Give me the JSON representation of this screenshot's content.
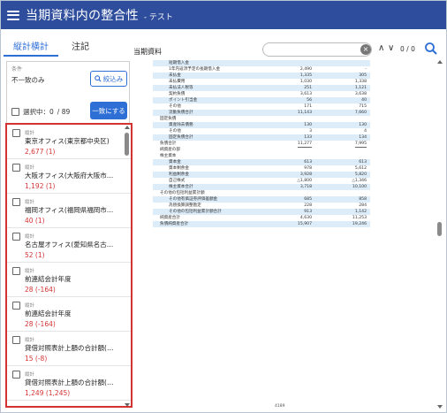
{
  "header": {
    "title": "当期資料内の整合性",
    "subtitle": "- テスト"
  },
  "tabs": [
    {
      "label": "縦計横計"
    },
    {
      "label": "注記"
    }
  ],
  "condition": {
    "label": "条件",
    "value": "不一致のみ",
    "narrow_button": "絞込み"
  },
  "selection": {
    "label": "選択中：0",
    "total": "/ 89",
    "match_button": "一致にする"
  },
  "list": [
    {
      "tag": "縦計",
      "name": "東京オフィス(東京都中央区)",
      "value": "2,677 (1)"
    },
    {
      "tag": "縦計",
      "name": "大阪オフィス(大阪府大阪市北区)",
      "value": "1,192 (1)"
    },
    {
      "tag": "縦計",
      "name": "福岡オフィス(福岡県福岡市博...",
      "value": "40 (1)"
    },
    {
      "tag": "縦計",
      "name": "名古屋オフィス(愛知県名古屋...",
      "value": "52 (1)"
    },
    {
      "tag": "縦計",
      "name": "前連結会計年度",
      "value": "28 (-164)"
    },
    {
      "tag": "縦計",
      "name": "前連結会計年度",
      "value": "28 (-164)"
    },
    {
      "tag": "縦計",
      "name": "貸借対照表計上額の合計額(百...",
      "value": "15 (-8)"
    },
    {
      "tag": "縦計",
      "name": "貸借対照表計上額の合計額(百...",
      "value": "1,249 (1,245)"
    }
  ],
  "viewer": {
    "doc_label": "当期資料",
    "search_placeholder": "",
    "match_count": "0 / 0",
    "page_footer": "4189"
  },
  "doc_rows": [
    {
      "label": "短期借入金",
      "c1": "",
      "c2": "",
      "indent": 1,
      "hl": true
    },
    {
      "label": "1年内返済予定の長期借入金",
      "c1": "2,490",
      "c2": "-",
      "indent": 1,
      "hl": false
    },
    {
      "label": "未払金",
      "c1": "1,335",
      "c2": "305",
      "indent": 1,
      "hl": true
    },
    {
      "label": "未払費用",
      "c1": "1,030",
      "c2": "1,338",
      "indent": 1,
      "hl": false
    },
    {
      "label": "未払法人税等",
      "c1": "251",
      "c2": "1,121",
      "indent": 1,
      "hl": true
    },
    {
      "label": "契約負債",
      "c1": "3,613",
      "c2": "3,638",
      "indent": 1,
      "hl": false
    },
    {
      "label": "ポイント引当金",
      "c1": "56",
      "c2": "40",
      "indent": 1,
      "hl": true
    },
    {
      "label": "その他",
      "c1": "171",
      "c2": "715",
      "indent": 1,
      "hl": false,
      "uline": true
    },
    {
      "label": "流動負債合計",
      "c1": "11,143",
      "c2": "7,660",
      "indent": 1,
      "hl": true
    },
    {
      "label": "固定負債",
      "c1": "",
      "c2": "",
      "indent": 0,
      "hl": false
    },
    {
      "label": "資産除去債務",
      "c1": "130",
      "c2": "130",
      "indent": 1,
      "hl": true
    },
    {
      "label": "その他",
      "c1": "3",
      "c2": "4",
      "indent": 1,
      "hl": false,
      "uline": true
    },
    {
      "label": "固定負債合計",
      "c1": "133",
      "c2": "134",
      "indent": 1,
      "hl": true
    },
    {
      "label": "負債合計",
      "c1": "11,277",
      "c2": "7,995",
      "indent": 0,
      "hl": false,
      "uline": true
    },
    {
      "label": "純資産の部",
      "c1": "",
      "c2": "",
      "indent": 0,
      "hl": false
    },
    {
      "label": "株主資本",
      "c1": "",
      "c2": "",
      "indent": 0,
      "hl": false
    },
    {
      "label": "資本金",
      "c1": "613",
      "c2": "613",
      "indent": 1,
      "hl": true
    },
    {
      "label": "資本剰余金",
      "c1": "978",
      "c2": "5,612",
      "indent": 1,
      "hl": false
    },
    {
      "label": "利益剰余金",
      "c1": "3,928",
      "c2": "5,820",
      "indent": 1,
      "hl": true
    },
    {
      "label": "自己株式",
      "c1": "△1,800",
      "c2": "△1,346",
      "indent": 1,
      "hl": false,
      "uline": true
    },
    {
      "label": "株主資本合計",
      "c1": "3,718",
      "c2": "10,100",
      "indent": 1,
      "hl": true
    },
    {
      "label": "その他の包括利益累計額",
      "c1": "",
      "c2": "",
      "indent": 0,
      "hl": false
    },
    {
      "label": "その他有価証券評価差額金",
      "c1": "685",
      "c2": "858",
      "indent": 1,
      "hl": true
    },
    {
      "label": "為替換算調整勘定",
      "c1": "228",
      "c2": "284",
      "indent": 1,
      "hl": false,
      "uline": true
    },
    {
      "label": "その他の包括利益累計額合計",
      "c1": "913",
      "c2": "1,142",
      "indent": 1,
      "hl": true
    },
    {
      "label": "純資産合計",
      "c1": "4,630",
      "c2": "11,253",
      "indent": 0,
      "hl": false,
      "uline": true
    },
    {
      "label": "負債純資産合計",
      "c1": "15,907",
      "c2": "19,246",
      "indent": 0,
      "hl": true
    }
  ],
  "colors": {
    "header": "#2e4d9c",
    "accent": "#2e6fd6",
    "alert": "#d43333",
    "row_highlight": "#dcecf9"
  }
}
